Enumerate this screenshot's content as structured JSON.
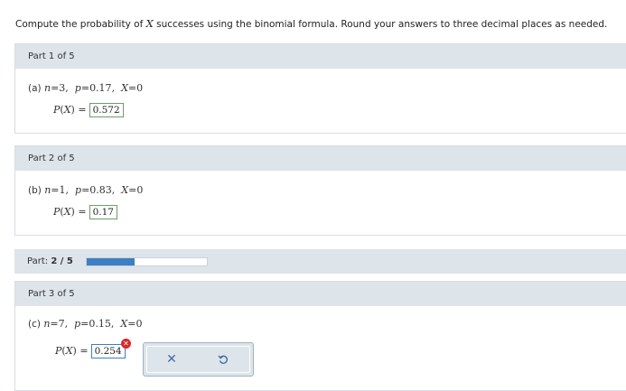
{
  "instructions": {
    "before": "Compute the probability of ",
    "var": "X",
    "after": " successes using the binomial formula. Round your answers to three decimal places as needed."
  },
  "parts": [
    {
      "header": "Part 1 of 5",
      "label": "(a)",
      "n": "3",
      "p": "0.17",
      "x": "0",
      "answer": "0.572"
    },
    {
      "header": "Part 2 of 5",
      "label": "(b)",
      "n": "1",
      "p": "0.83",
      "x": "0",
      "answer": "0.17"
    },
    {
      "header": "Part 3 of 5",
      "label": "(c)",
      "n": "7",
      "p": "0.15",
      "x": "0",
      "answer": "0.254"
    }
  ],
  "progress": {
    "label": "Part:",
    "value": "2 / 5",
    "fraction": 0.4,
    "color": "#3d7fc2"
  },
  "prob_label": "P(X) =",
  "actions": {
    "clear_icon": "x-icon",
    "undo_icon": "undo-icon"
  },
  "error_icon": "error-x-icon"
}
